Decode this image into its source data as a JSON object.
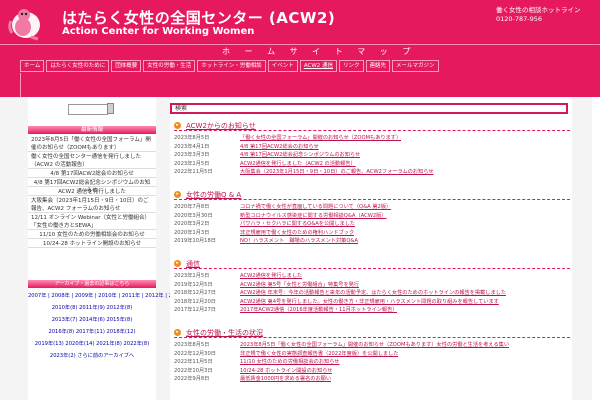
{
  "header": {
    "title_jp": "はたらく女性の全国センター (ACW2)",
    "title_en": "Action Center for Working Women",
    "phone": "働く女性の相談ホットライン 0120-787-956",
    "logo_text": "ACW2"
  },
  "strip_text": "ホ ー ム  サ イ ト マ ッ プ",
  "nav": [
    "ホーム",
    "はたらく女性のために",
    "団体概要",
    "女性の労働・生活",
    "ホットライン・労働相談",
    "イベント",
    "ACW2 通信",
    "リンク",
    "連絡先",
    "メールマガジン"
  ],
  "nav_active_index": 6,
  "sidebar": {
    "search_value": "",
    "box_title": "最新情報",
    "items": [
      "2023年8月5日「働く女性の全国フォーラム」開催のお知らせ（ZOOMもあります）",
      "働く女性の全国センター通信を発行しました（ACW2 の活動報告）",
      "4/8 第17回ACW2総会のお知らせ",
      "4/8 第17回ACW2総会記念シンポジウムのお知らせ",
      "ACW2 通信を発行しました",
      "大阪集会（2023年1月15日・9日・10日）のご報告、ACW2 フォーラムのお知らせ",
      "12/11 オンライン Webinar（女性と労働組合）「女性の働き方とSEWA」",
      "11/10 女性のための労働相談会のお知らせ",
      "10/24-28 ホットライン開設のお知らせ"
    ],
    "archive_title": "アーカイブ・過去の記事はこちら",
    "archive": [
      "2007年 | 2008年 | 2009年 | 2010年 | 2011年 | 2012年 | 2009年(8)",
      "2010年(8) 2011年(9) 2012年(8)",
      "2013年(7) 2014年(6) 2015年(8)",
      "2016年(8) 2017年(11) 2018年(12)",
      "2019年(13) 2020年(14) 2021年(8)  2022年(8)",
      "2023年(2) さらに前のアーカイブへ"
    ]
  },
  "search_bar_text": "検索",
  "sections": [
    {
      "title": "ACW2からのお知らせ",
      "rows": [
        {
          "date": "2023年8月5日",
          "text": "「働く女性の全国フォーラム」開催のお知らせ（ZOOMもあります）"
        },
        {
          "date": "2023年4月1日",
          "text": "4/8 第17回ACW2総会のお知らせ"
        },
        {
          "date": "2023年3月3日",
          "text": "4/8 第17回ACW2総会記念シンポジウムのお知らせ"
        },
        {
          "date": "2023年1月5日",
          "text": "ACW2通信を発行しました（ACW2 の活動報告）"
        },
        {
          "date": "2022年11月5日",
          "text": "大阪集会（2023年1月15日・9日・10日）のご報告、ACW2フォーラムのお知らせ"
        }
      ]
    },
    {
      "title": "女性の労働Q & A",
      "rows": [
        {
          "date": "2020年7月8日",
          "text": "コロナ禍で働く女性が直面している問題について（Q&A 第2版）"
        },
        {
          "date": "2020年3月30日",
          "text": "新型コロナウイルス感染症に関する労働相談Q&A（ACW2版）"
        },
        {
          "date": "2020年3月2日",
          "text": "パワハラ・セクハラに関するQ&Aを公開しました"
        },
        {
          "date": "2020年1月3日",
          "text": "非正規雇用で働く女性のための権利ハンドブック"
        },
        {
          "date": "2019年10月18日",
          "text": "NO！ハラスメント　職場のハラスメント対策Q&A"
        }
      ]
    },
    {
      "title": "通信",
      "rows": [
        {
          "date": "2023年1月5日",
          "text": "ACW2通信を発行しました"
        },
        {
          "date": "2019年12月5日",
          "text": "ACW2通信 第5号「女性と労働組合」特集号を発行"
        },
        {
          "date": "2018年12月27日",
          "text": "ACW2通信 年末号：今年の活動報告と来年の活動予定、はたらく女性のためのホットラインの報告を掲載しました"
        },
        {
          "date": "2018年12月20日",
          "text": "ACW2通信 第4号を発行しました。女性の働き方・非正規雇用・ハラスメント問題の取り組みを報告しています"
        },
        {
          "date": "2017年12月27日",
          "text": "2017年ACW2通信（2016年度活動報告・11月ホットライン報告）"
        }
      ]
    },
    {
      "title": "女性の労働・生活の状況",
      "rows": [
        {
          "date": "2023年8月5日",
          "text": "2023年8月5日「働く女性の全国フォーラム」開催のお知らせ（ZOOMもあります）女性の労働と生活を考える集い"
        },
        {
          "date": "2022年12月30日",
          "text": "非正規で働く女性の実態調査報告書（2022年度版）を公開しました"
        },
        {
          "date": "2022年11月5日",
          "text": "11/10 女性のための労働相談会のお知らせ"
        },
        {
          "date": "2022年10月3日",
          "text": "10/24-28 ホットライン開設のお知らせ"
        },
        {
          "date": "2022年9月8日",
          "text": "最低賃金1000円を求める署名のお願い"
        }
      ]
    }
  ]
}
